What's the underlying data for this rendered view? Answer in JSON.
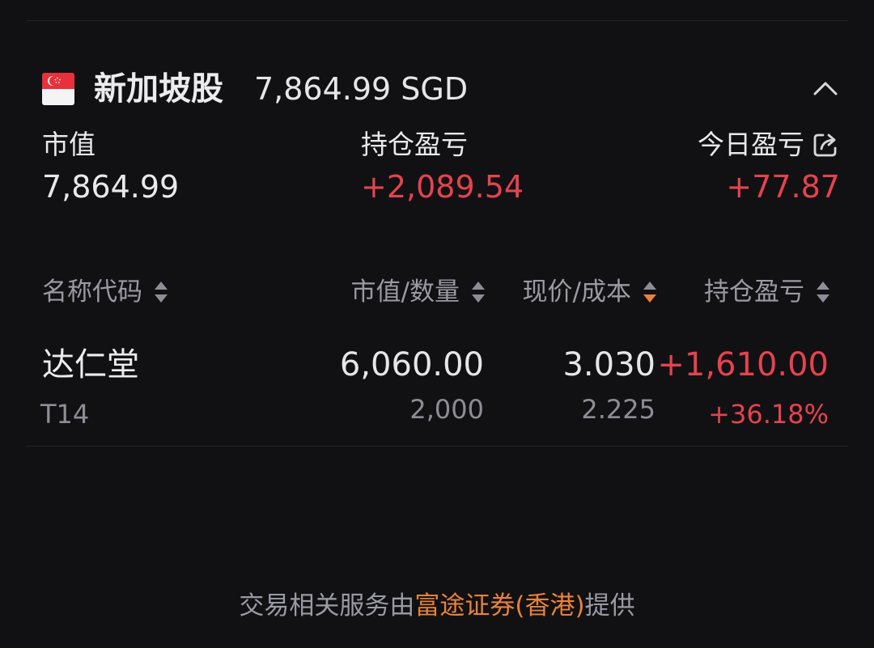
{
  "colors": {
    "background": "#111114",
    "up_red": "#e5434e",
    "accent_orange": "#e8823a",
    "muted": "#9a9aa2"
  },
  "market": {
    "flag_icon": "singapore-flag-icon",
    "name": "新加坡股",
    "total": "7,864.99 SGD",
    "collapse_icon": "chevron-up-icon"
  },
  "summary": {
    "market_value_label": "市值",
    "market_value": "7,864.99",
    "position_pl_label": "持仓盈亏",
    "position_pl": "+2,089.54",
    "today_pl_label": "今日盈亏",
    "today_pl": "+77.87",
    "share_icon": "share-icon"
  },
  "columns": [
    {
      "label": "名称代码",
      "sort": "none"
    },
    {
      "label": "市值/数量",
      "sort": "none"
    },
    {
      "label": "现价/成本",
      "sort": "descending"
    },
    {
      "label": "持仓盈亏",
      "sort": "none"
    }
  ],
  "holdings": [
    {
      "name": "达仁堂",
      "code": "T14",
      "market_value": "6,060.00",
      "quantity": "2,000",
      "price": "3.030",
      "cost": "2.225",
      "pl": "+1,610.00",
      "pl_pct": "+36.18%"
    }
  ],
  "footer": {
    "prefix": "交易相关服务由",
    "broker": "富途证券(香港)",
    "suffix": "提供"
  }
}
